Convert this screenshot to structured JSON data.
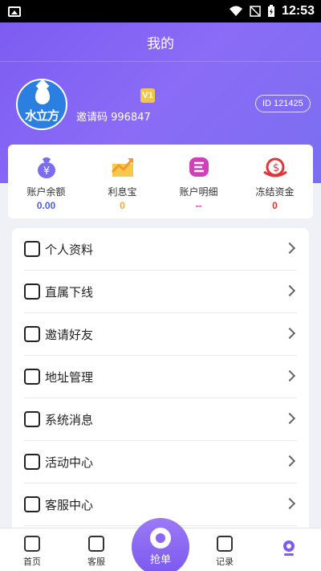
{
  "status": {
    "time": "12:53"
  },
  "header": {
    "title": "我的"
  },
  "profile": {
    "brand": "水立方",
    "vip_level": "V1",
    "invite_label": "邀请码",
    "invite_code": "996847",
    "invite_text": "邀请码 996847",
    "id_text": "ID 121425"
  },
  "stats": [
    {
      "label": "账户余额",
      "value": "0.00",
      "color": "#4a5cf0"
    },
    {
      "label": "利息宝",
      "value": "0",
      "color": "#f2a833"
    },
    {
      "label": "账户明细",
      "value": "--",
      "color": "#d23fb8"
    },
    {
      "label": "冻结资金",
      "value": "0",
      "color": "#e0363a"
    }
  ],
  "menu": [
    {
      "label": "个人资料",
      "icon": "profile-icon"
    },
    {
      "label": "直属下线",
      "icon": "team-icon"
    },
    {
      "label": "邀请好友",
      "icon": "invite-icon"
    },
    {
      "label": "地址管理",
      "icon": "location-icon"
    },
    {
      "label": "系统消息",
      "icon": "message-icon"
    },
    {
      "label": "活动中心",
      "icon": "activity-icon"
    },
    {
      "label": "客服中心",
      "icon": "service-icon"
    }
  ],
  "nav": {
    "home": "首页",
    "service": "客服",
    "grab": "抢单",
    "records": "记录",
    "me": ""
  },
  "colors": {
    "accent": "#7d5cf2"
  }
}
